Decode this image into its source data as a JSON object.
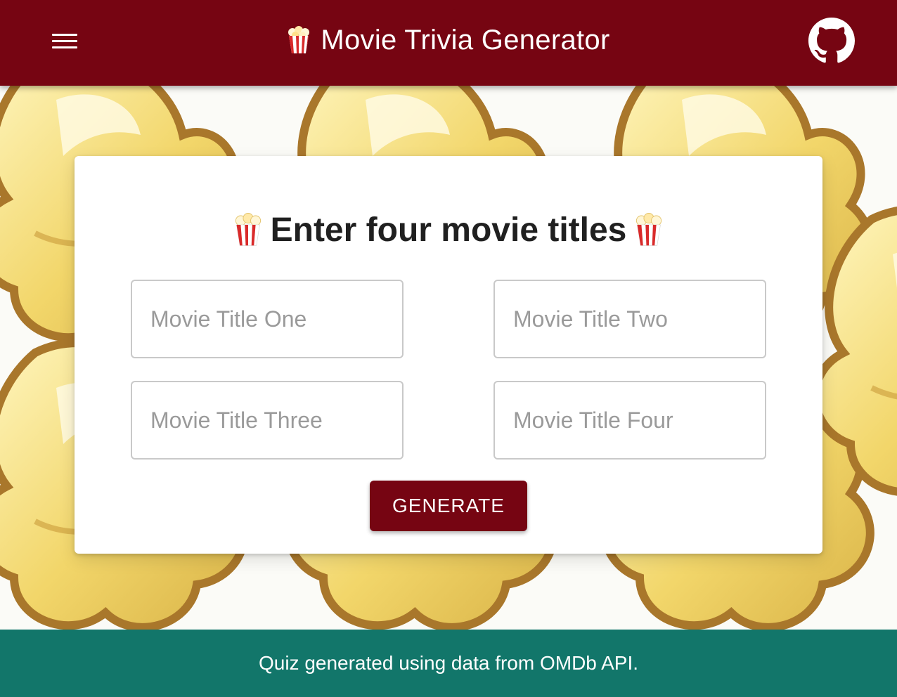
{
  "header": {
    "menu_icon": "hamburger-menu-icon",
    "title_icon": "popcorn-emoji",
    "title": "Movie Trivia Generator",
    "github_icon": "github-icon",
    "background_color": "#760512"
  },
  "card": {
    "heading": "Enter four movie titles",
    "heading_icon": "popcorn-emoji",
    "fields": [
      {
        "placeholder": "Movie Title One",
        "value": ""
      },
      {
        "placeholder": "Movie Title Two",
        "value": ""
      },
      {
        "placeholder": "Movie Title Three",
        "value": ""
      },
      {
        "placeholder": "Movie Title Four",
        "value": ""
      }
    ],
    "generate_label": "GENERATE"
  },
  "footer": {
    "text": "Quiz generated using data from OMDb API.",
    "background_color": "#12766a"
  }
}
